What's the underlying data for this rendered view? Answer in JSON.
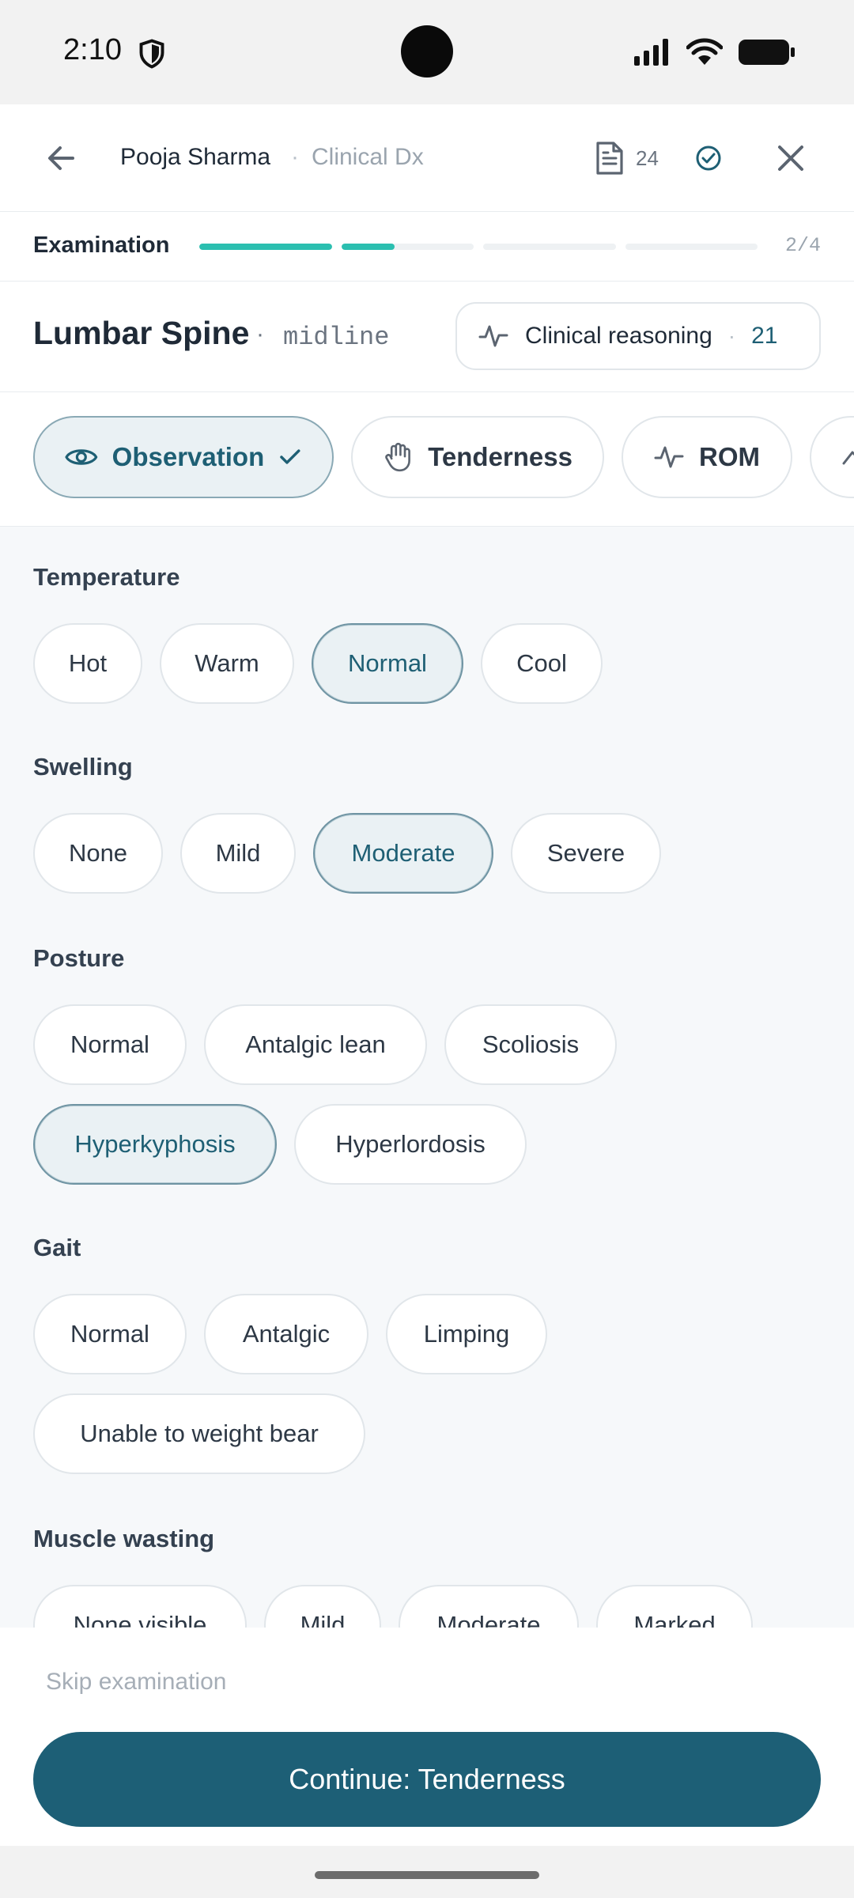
{
  "status_bar": {
    "time": "2:10"
  },
  "header": {
    "patient_name": "Pooja Sharma",
    "separator": "·",
    "session_type": "Clinical Dx",
    "notes_count": "24"
  },
  "progress": {
    "label": "Examination",
    "step_text": "2/4",
    "segments": [
      1,
      1,
      0,
      0
    ],
    "current_fraction": 0.4
  },
  "region": {
    "title": "Lumbar Spine",
    "dot": "·",
    "side": "midline",
    "reasoning": {
      "label": "Clinical reasoning",
      "dot": "·",
      "count": "21"
    }
  },
  "tabs": [
    {
      "label": "Observation",
      "active": true,
      "icon": "eye-icon",
      "done": true
    },
    {
      "label": "Tenderness",
      "active": false,
      "icon": "hand-icon"
    },
    {
      "label": "ROM",
      "active": false,
      "icon": "activity-icon"
    }
  ],
  "groups": [
    {
      "label": "Temperature",
      "options": [
        "Hot",
        "Warm",
        "Normal",
        "Cool"
      ],
      "selected": "Normal"
    },
    {
      "label": "Swelling",
      "options": [
        "None",
        "Mild",
        "Moderate",
        "Severe"
      ],
      "selected": "Moderate"
    },
    {
      "label": "Posture",
      "options": [
        "Normal",
        "Antalgic lean",
        "Scoliosis",
        "Hyperkyphosis",
        "Hyperlordosis"
      ],
      "selected": "Hyperkyphosis"
    },
    {
      "label": "Gait",
      "options": [
        "Normal",
        "Antalgic",
        "Limping",
        "Unable to weight bear"
      ],
      "selected": null
    },
    {
      "label": "Muscle wasting",
      "options": [
        "None visible",
        "Mild",
        "Moderate",
        "Marked"
      ],
      "selected": null
    }
  ],
  "footer": {
    "skip_label": "Skip examination",
    "continue_label": "Continue: Tenderness"
  },
  "colors": {
    "accent": "#1d5f76",
    "progress": "#2bbfb0",
    "selected_bg": "#eaf1f4"
  }
}
